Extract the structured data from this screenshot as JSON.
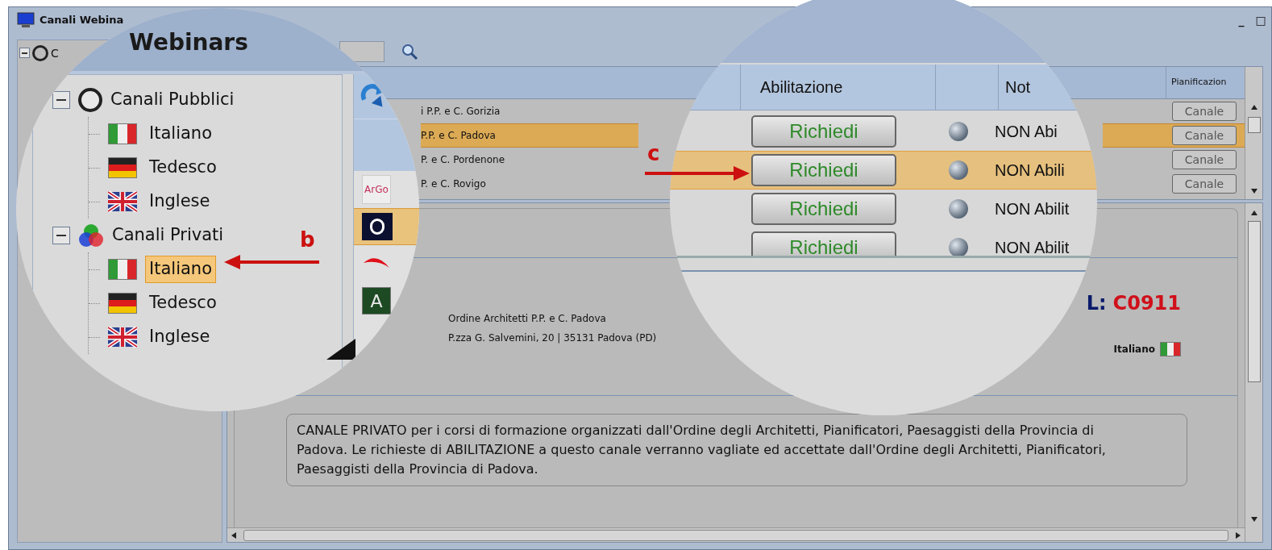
{
  "window": {
    "title": "Canali Webina",
    "controls": [
      "_",
      "□"
    ]
  },
  "tree_root": {
    "label": "C",
    "expanded": true
  },
  "table": {
    "header": "Pianificazion",
    "rows": [
      {
        "name": "i P.P. e C. Gorizia",
        "action": "Canale",
        "selected": false
      },
      {
        "name": "P.P. e C. Padova",
        "action": "Canale",
        "selected": true
      },
      {
        "name": "P. e C. Pordenone",
        "action": "Canale",
        "selected": false
      },
      {
        "name": "P. e C. Rovigo",
        "action": "Canale",
        "selected": false
      }
    ]
  },
  "detail": {
    "org": "Ordine Architetti P.P. e C. Padova",
    "address": "P.zza G. Salvemini, 20 | 35131 Padova (PD)",
    "code_label": "L:",
    "code": "C0911",
    "language": "Italiano",
    "description": "CANALE PRIVATO per i corsi di formazione organizzati dall'Ordine degli Architetti, Pianificatori, Paesaggisti della Provincia di Padova. Le richieste di ABILITAZIONE a questo canale verranno vagliate ed accettate dall'Ordine degli Architetti, Pianificatori, Paesaggisti della Provincia di Padova."
  },
  "zoom_tree": {
    "title": "Webinars",
    "groups": [
      {
        "label": "Canali Pubblici",
        "kind": "public",
        "expanded": true,
        "children": [
          {
            "label": "Italiano",
            "kind": "it",
            "selected": false
          },
          {
            "label": "Tedesco",
            "kind": "de",
            "selected": false
          },
          {
            "label": "Inglese",
            "kind": "en",
            "selected": false
          }
        ]
      },
      {
        "label": "Canali Privati",
        "kind": "private",
        "expanded": true,
        "children": [
          {
            "label": "Italiano",
            "kind": "it",
            "selected": true
          },
          {
            "label": "Tedesco",
            "kind": "de",
            "selected": false
          },
          {
            "label": "Inglese",
            "kind": "en",
            "selected": false
          }
        ]
      }
    ],
    "logos": [
      {
        "kind": "argo",
        "text": "ArGo",
        "selected": false
      },
      {
        "kind": "dark",
        "selected": true
      },
      {
        "kind": "red",
        "selected": false
      },
      {
        "kind": "green",
        "text": "A",
        "selected": false
      }
    ]
  },
  "zoom_table": {
    "columns": [
      "Abilitazione",
      "Not"
    ],
    "rows": [
      {
        "button": "Richiedi",
        "status": "NON Abi",
        "selected": false
      },
      {
        "button": "Richiedi",
        "status": "NON Abili",
        "selected": true
      },
      {
        "button": "Richiedi",
        "status": "NON Abilit",
        "selected": false
      },
      {
        "button": "Richiedi",
        "status": "NON Abilit",
        "selected": false
      }
    ]
  },
  "callouts": [
    {
      "letter": "b"
    },
    {
      "letter": "c"
    }
  ]
}
